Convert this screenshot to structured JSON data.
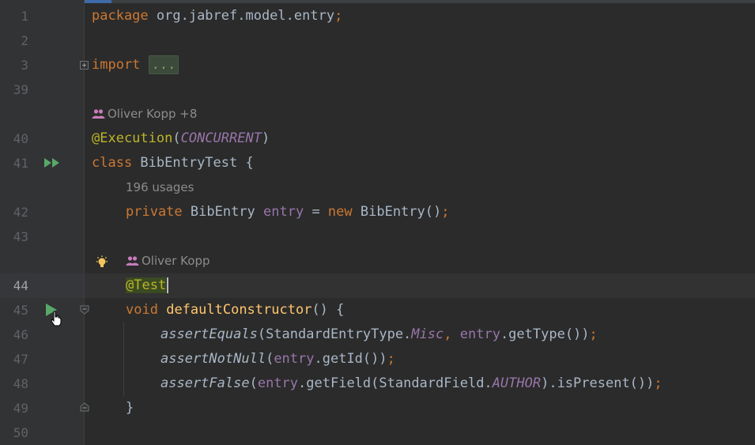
{
  "editor": {
    "line_numbers": [
      "1",
      "2",
      "3",
      "39",
      "40",
      "41",
      "42",
      "43",
      "44",
      "45",
      "46",
      "47",
      "48",
      "49",
      "50"
    ],
    "lines": {
      "l1": {
        "kw": "package",
        "rest": " org.jabref.model.entry",
        "semi": ";"
      },
      "l3": {
        "kw": "import",
        "space": " ",
        "folded": "..."
      },
      "l40": {
        "ann": "@Execution",
        "p1": "(",
        "enum": "CONCURRENT",
        "p2": ")"
      },
      "l41": {
        "kw": "class",
        "rest": " BibEntryTest {"
      },
      "l42": {
        "kw1": "private",
        "t1": " BibEntry ",
        "fld": "entry",
        "t2": " = ",
        "kw2": "new",
        "t3": " BibEntry()",
        "semi": ";"
      },
      "l44": {
        "ann": "@Test"
      },
      "l45": {
        "kw": "void",
        "sp": " ",
        "fn": "defaultConstructor",
        "rest": "() {"
      },
      "l46": {
        "m": "assertEquals",
        "a": "(StandardEntryType.",
        "c": "Misc",
        "comma": ",",
        "sp": " ",
        "fld": "entry",
        "b": ".getType())",
        "semi": ";"
      },
      "l47": {
        "m": "assertNotNull",
        "a": "(",
        "fld": "entry",
        "b": ".getId())",
        "semi": ";"
      },
      "l48": {
        "m": "assertFalse",
        "a": "(",
        "fld": "entry",
        "b": ".getField(StandardField.",
        "c": "AUTHOR",
        "d": ").isPresent())",
        "semi": ";"
      },
      "l49": {
        "brace": "}"
      }
    },
    "hints": {
      "class_author": "Oliver Kopp +8",
      "usages": "196 usages",
      "method_author": "Oliver Kopp"
    },
    "icons": {
      "run_all": "run-all-tests-icon",
      "run": "run-test-icon",
      "bulb": "intention-bulb-icon",
      "people": "people-icon"
    },
    "colors": {
      "keyword": "#cc7832",
      "annotation": "#bbb529",
      "function": "#ffc66d",
      "field": "#9876aa",
      "text": "#a9b7c6",
      "run": "#59a869"
    }
  }
}
